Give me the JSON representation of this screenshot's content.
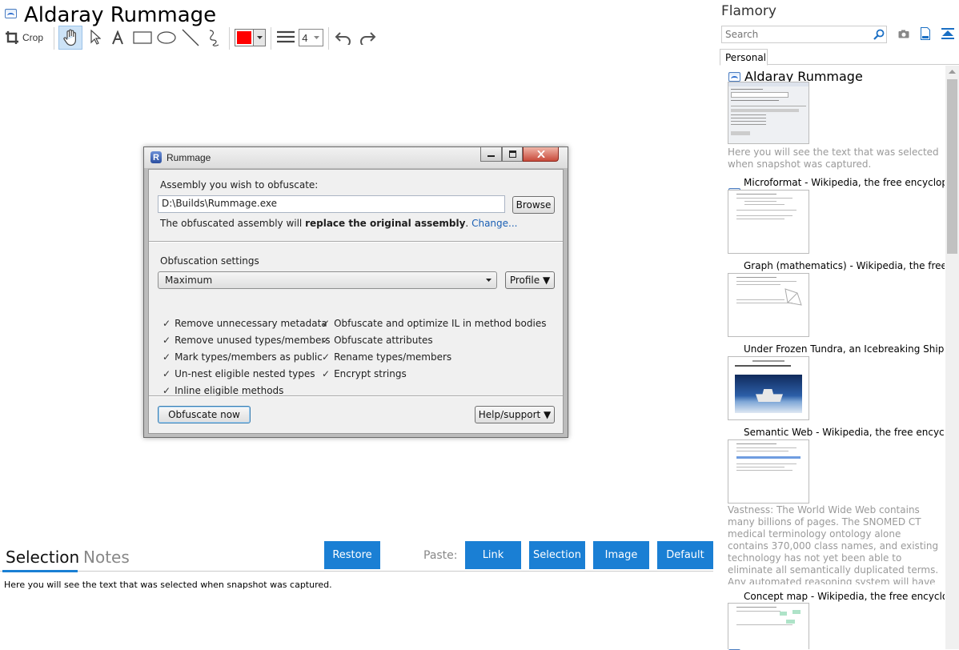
{
  "app": {
    "title": "Aldaray Rummage"
  },
  "toolbar": {
    "crop_label": "Crop",
    "color": "#ff0000",
    "line_width": "4"
  },
  "dialog": {
    "title": "Rummage",
    "assembly_label": "Assembly you wish to obfuscate:",
    "assembly_value": "D:\\Builds\\Rummage.exe",
    "browse_label": "Browse",
    "replace_text_prefix": "The obfuscated assembly will ",
    "replace_text_bold": "replace the original assembly",
    "replace_text_suffix": ".",
    "change_link": "Change...",
    "settings_label": "Obfuscation settings",
    "settings_value": "Maximum",
    "profile_label": "Profile ▼",
    "options_left": [
      "Remove unnecessary metadata",
      "Remove unused types/members",
      "Mark types/members as public",
      "Un-nest eligible nested types",
      "Inline eligible methods"
    ],
    "options_right": [
      "Obfuscate and optimize IL in method bodies",
      "Obfuscate attributes",
      "Rename types/members",
      "Encrypt strings"
    ],
    "check_mark": "✓",
    "obfuscate_label": "Obfuscate now",
    "help_label": "Help/support ▼"
  },
  "bottom": {
    "tab_selection": "Selection",
    "tab_notes": "Notes",
    "restore_label": "Restore",
    "paste_label": "Paste:",
    "paste_buttons": [
      "Link",
      "Selection",
      "Image",
      "Default"
    ],
    "selection_text": "Here you will see the text that was selected when snapshot was captured."
  },
  "sidebar": {
    "title": "Flamory",
    "search_placeholder": "Search",
    "tab_personal": "Personal",
    "entries": [
      {
        "title": "Aldaray Rummage",
        "desc": "Here you will see the text that was selected when snapshot was captured."
      },
      {
        "title": "Microformat - Wikipedia, the free encyclopedia"
      },
      {
        "title": "Graph (mathematics) - Wikipedia, the free encyclopedia"
      },
      {
        "title": "Under Frozen Tundra, an Icebreaking Ship Uncovers"
      },
      {
        "title": "Semantic Web - Wikipedia, the free encyclopedia",
        "desc": "Vastness: The World Wide Web contains many billions of pages. The SNOMED CT medical terminology ontology alone contains 370,000 class names, and existing technology has not yet been able to eliminate all semantically duplicated terms. Any automated reasoning system will have to deal with truly huge inputs."
      },
      {
        "title": "Concept map - Wikipedia, the free encyclopedia"
      }
    ]
  }
}
